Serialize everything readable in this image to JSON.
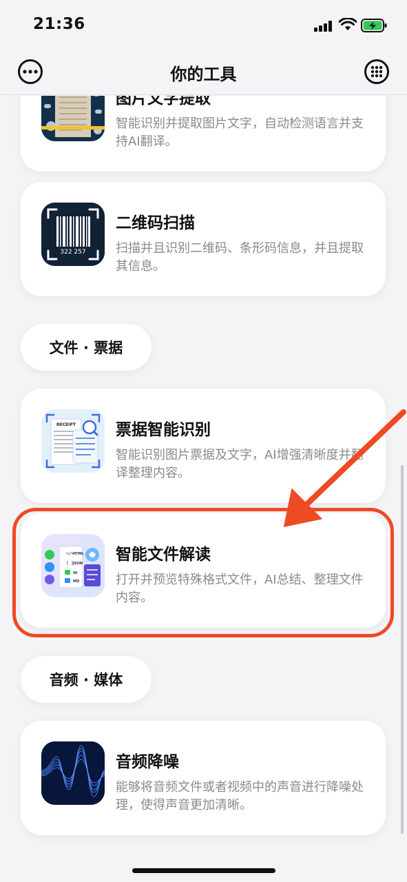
{
  "status_bar": {
    "time": "21:36"
  },
  "nav": {
    "title": "你的工具",
    "left_icon": "more-icon",
    "right_icon": "grid-icon"
  },
  "sections": [
    {
      "label": "文件 · 票据"
    },
    {
      "label": "音频 · 媒体"
    }
  ],
  "tools": [
    {
      "title": "图片文字提取",
      "desc": "智能识别并提取图片文字，自动检测语言并支持AI翻译。",
      "icon": "image-text-icon"
    },
    {
      "title": "二维码扫描",
      "desc": "扫描并且识别二维码、条形码信息，并且提取其信息。",
      "icon": "barcode-icon",
      "icon_text": "322 257"
    },
    {
      "title": "票据智能识别",
      "desc": "智能识别图片票据及文字，AI增强清晰度并翻译整理内容。",
      "icon": "receipt-icon",
      "icon_text": "RECEIPT"
    },
    {
      "title": "智能文件解读",
      "desc": "打开并预览特殊格式文件，AI总结、整理文件内容。",
      "icon": "file-ai-icon",
      "icon_items": [
        "HTML",
        "JSON",
        "IN",
        "MD"
      ]
    },
    {
      "title": "音频降噪",
      "desc": "能够将音频文件或者视频中的声音进行降噪处理，使得声音更加清晰。",
      "icon": "audio-wave-icon"
    }
  ],
  "colors": {
    "accent": "#ee4a24",
    "text_secondary": "#8a8a8f",
    "battery": "#34c759"
  }
}
